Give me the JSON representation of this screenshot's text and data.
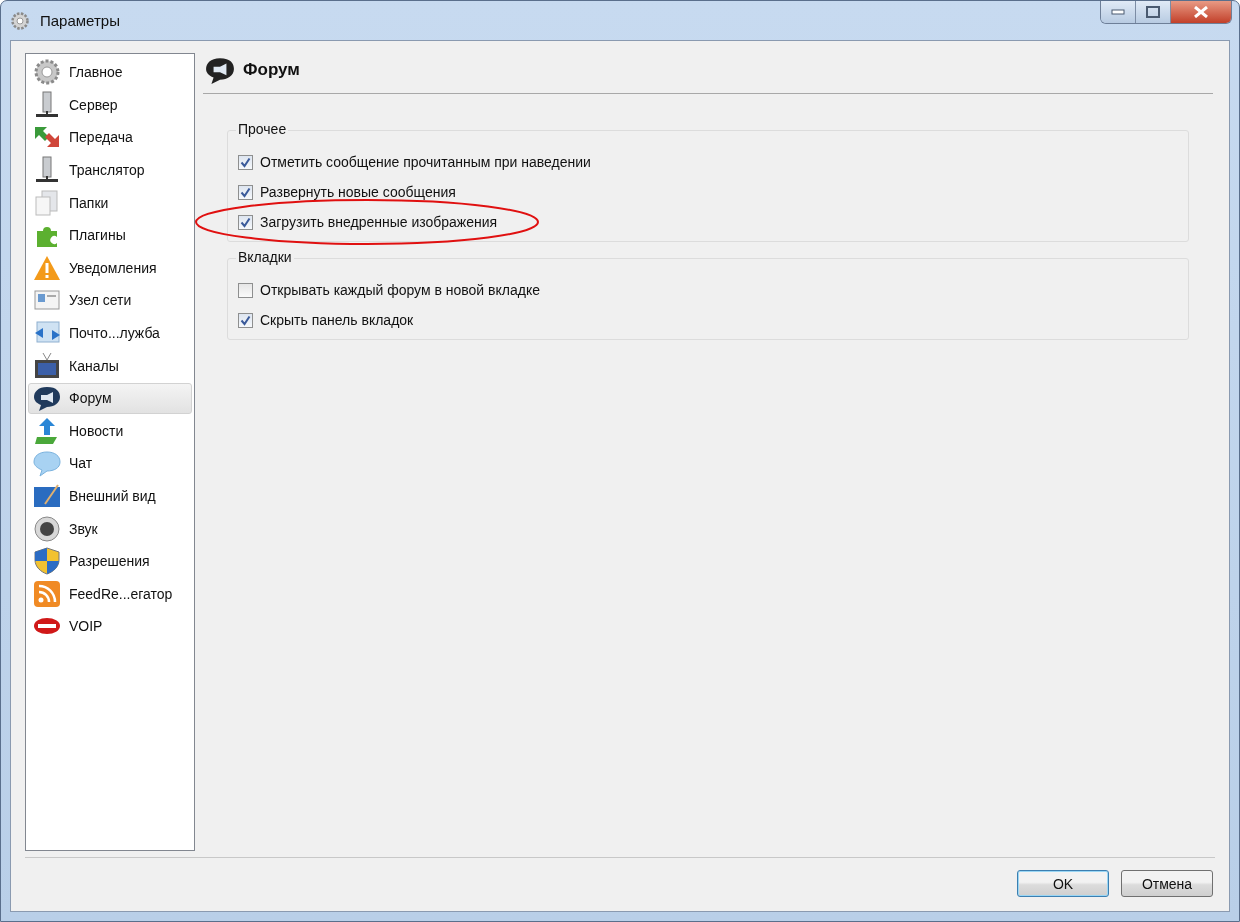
{
  "window": {
    "title": "Параметры"
  },
  "sidebar": {
    "items": [
      {
        "label": "Главное",
        "selected": false
      },
      {
        "label": "Сервер",
        "selected": false
      },
      {
        "label": "Передача",
        "selected": false
      },
      {
        "label": "Транслятор",
        "selected": false
      },
      {
        "label": "Папки",
        "selected": false
      },
      {
        "label": "Плагины",
        "selected": false
      },
      {
        "label": "Уведомления",
        "selected": false
      },
      {
        "label": "Узел сети",
        "selected": false
      },
      {
        "label": "Почто...лужба",
        "selected": false
      },
      {
        "label": "Каналы",
        "selected": false
      },
      {
        "label": "Форум",
        "selected": true
      },
      {
        "label": "Новости",
        "selected": false
      },
      {
        "label": "Чат",
        "selected": false
      },
      {
        "label": "Внешний вид",
        "selected": false
      },
      {
        "label": "Звук",
        "selected": false
      },
      {
        "label": "Разрешения",
        "selected": false
      },
      {
        "label": "FeedRe...егатор",
        "selected": false
      },
      {
        "label": "VOIP",
        "selected": false
      }
    ]
  },
  "page": {
    "title": "Форум"
  },
  "groups": [
    {
      "title": "Прочее",
      "options": [
        {
          "label": "Отметить сообщение прочитанным при наведении",
          "checked": true,
          "highlighted": false
        },
        {
          "label": "Развернуть новые сообщения",
          "checked": true,
          "highlighted": false
        },
        {
          "label": "Загрузить внедренные изображения",
          "checked": true,
          "highlighted": true
        }
      ]
    },
    {
      "title": "Вкладки",
      "options": [
        {
          "label": "Открывать каждый форум в новой вкладке",
          "checked": false,
          "highlighted": false
        },
        {
          "label": "Скрыть панель вкладок",
          "checked": true,
          "highlighted": false
        }
      ]
    }
  ],
  "buttons": [
    {
      "label": "OK",
      "default": true
    },
    {
      "label": "Отмена",
      "default": false
    }
  ]
}
